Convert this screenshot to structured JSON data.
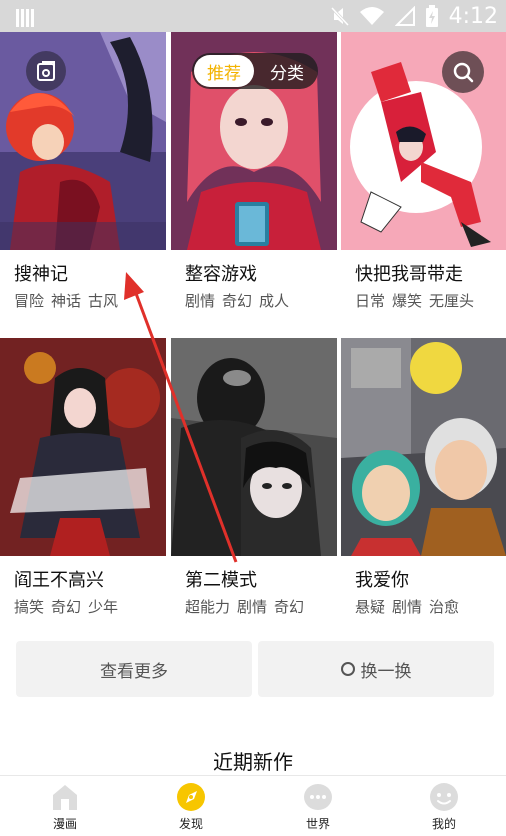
{
  "status_bar": {
    "time": "4:12",
    "icons": [
      "notification-icon",
      "mute-icon",
      "wifi-icon",
      "signal-icon",
      "battery-icon"
    ]
  },
  "top_tabs": {
    "recommend": "推荐",
    "category": "分类",
    "active": "推荐",
    "accent_color": "#f3b300"
  },
  "floating_icons": {
    "left": "bookshelf-icon",
    "right": "search-icon"
  },
  "comics": [
    {
      "title": "搜神记",
      "tags": [
        "冒险",
        "神话",
        "古风"
      ]
    },
    {
      "title": "整容游戏",
      "tags": [
        "剧情",
        "奇幻",
        "成人"
      ]
    },
    {
      "title": "快把我哥带走",
      "tags": [
        "日常",
        "爆笑",
        "无厘头"
      ]
    },
    {
      "title": "阎王不高兴",
      "tags": [
        "搞笑",
        "奇幻",
        "少年"
      ]
    },
    {
      "title": "第二模式",
      "tags": [
        "超能力",
        "剧情",
        "奇幻"
      ]
    },
    {
      "title": "我爱你",
      "tags": [
        "悬疑",
        "剧情",
        "治愈"
      ]
    }
  ],
  "actions": {
    "view_more": "查看更多",
    "swap": "换一换"
  },
  "section_title": "近期新作",
  "bottom_nav": [
    {
      "label": "漫画",
      "icon": "home-icon"
    },
    {
      "label": "发现",
      "icon": "discover-icon",
      "active": true
    },
    {
      "label": "世界",
      "icon": "world-icon"
    },
    {
      "label": "我的",
      "icon": "profile-icon"
    }
  ],
  "colors": {
    "accent": "#f3b300",
    "annotation_arrow": "#e0302a"
  }
}
